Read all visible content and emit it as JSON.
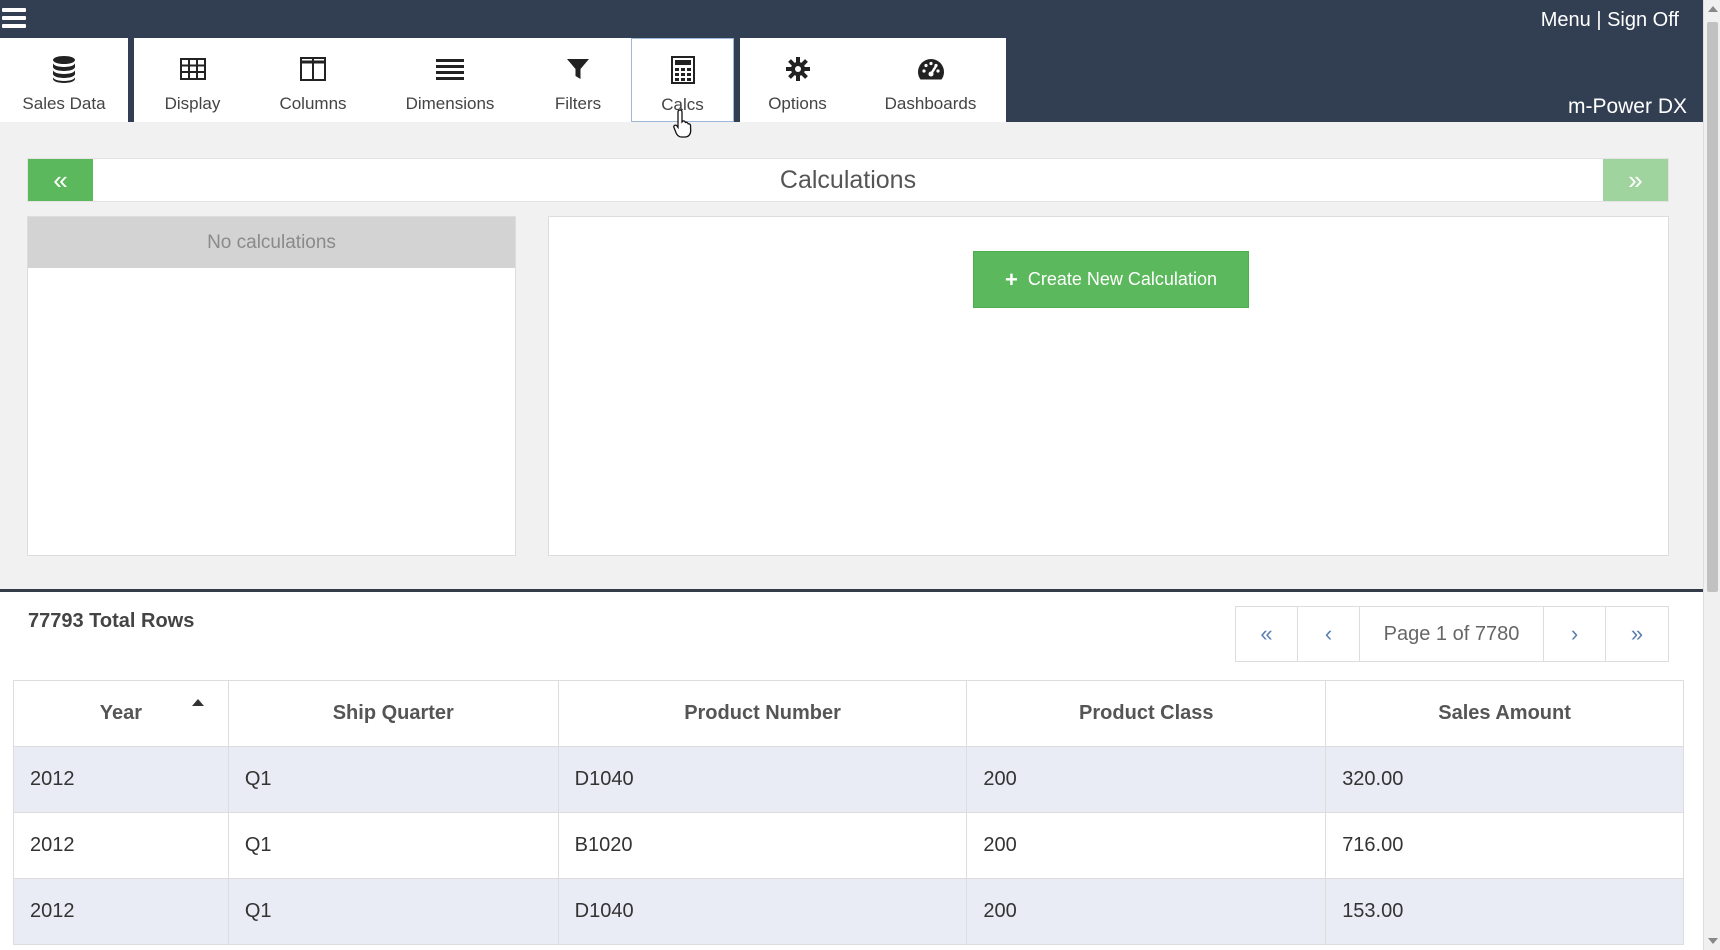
{
  "header": {
    "menu_link": "Menu",
    "separator": "|",
    "signoff_link": "Sign Off",
    "brand": "m-Power DX"
  },
  "tabs": [
    {
      "label": "Sales Data",
      "icon": "database-icon"
    },
    {
      "label": "Display",
      "icon": "table-grid-icon"
    },
    {
      "label": "Columns",
      "icon": "columns-icon"
    },
    {
      "label": "Dimensions",
      "icon": "list-lines-icon"
    },
    {
      "label": "Filters",
      "icon": "filter-funnel-icon"
    },
    {
      "label": "Calcs",
      "icon": "calculator-icon",
      "active": true
    },
    {
      "label": "Options",
      "icon": "gear-icon"
    },
    {
      "label": "Dashboards",
      "icon": "gauge-icon"
    }
  ],
  "calc_panel": {
    "prev_glyph": "«",
    "next_glyph": "»",
    "title": "Calculations",
    "list_empty_text": "No calculations",
    "create_plus": "+",
    "create_label": "Create New Calculation"
  },
  "grid": {
    "total_rows_text": "77793 Total Rows",
    "pager": {
      "first": "«",
      "prev": "‹",
      "info": "Page 1 of 7780",
      "next": "›",
      "last": "»"
    },
    "columns": [
      "Year",
      "Ship Quarter",
      "Product Number",
      "Product Class",
      "Sales Amount"
    ],
    "rows": [
      [
        "2012",
        "Q1",
        "D1040",
        "200",
        "320.00"
      ],
      [
        "2012",
        "Q1",
        "B1020",
        "200",
        "716.00"
      ],
      [
        "2012",
        "Q1",
        "D1040",
        "200",
        "153.00"
      ]
    ]
  },
  "colors": {
    "topbar": "#323f52",
    "accent_green": "#5cb85c",
    "row_alt": "#e9ecf5"
  }
}
